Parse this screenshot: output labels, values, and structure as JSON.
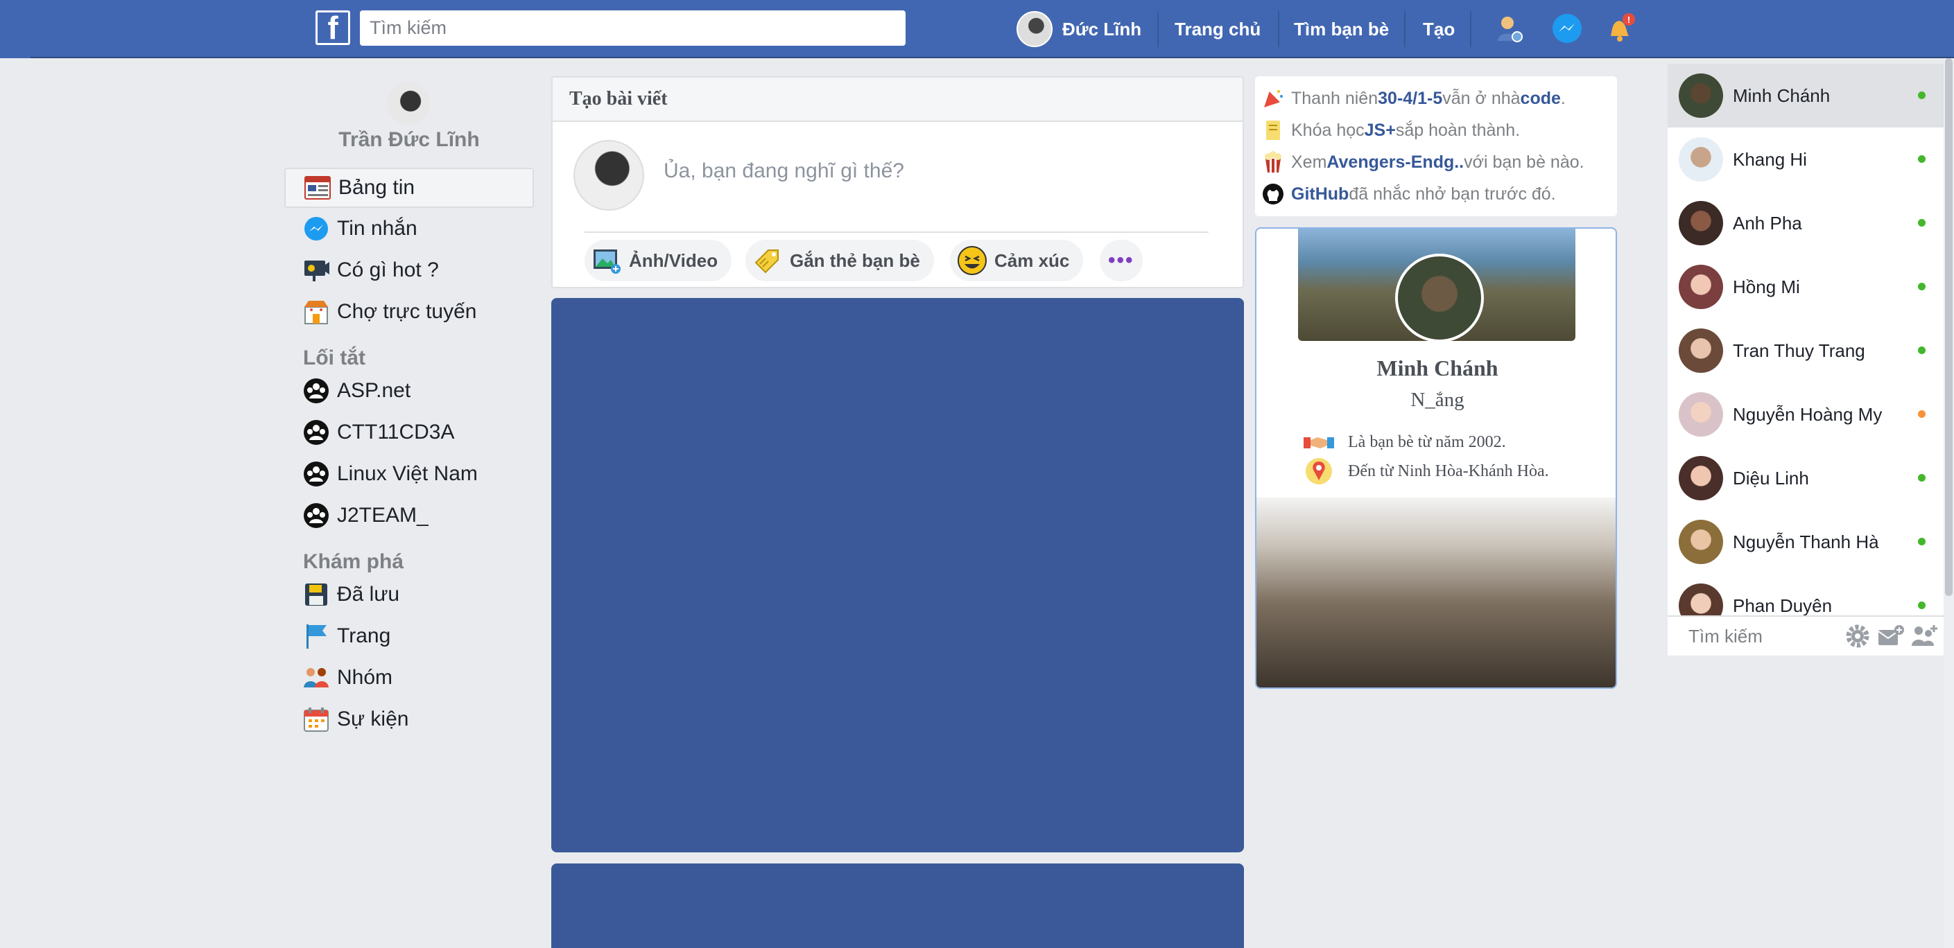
{
  "topbar": {
    "logo_letter": "f",
    "search_placeholder": "Tìm kiếm",
    "user_name": "Đức Lĩnh",
    "nav": [
      "Trang chủ",
      "Tìm bạn bè",
      "Tạo"
    ],
    "notification_badge": "!",
    "colors": {
      "bar": "#4267b2",
      "text": "#ffffff"
    }
  },
  "left_sidebar": {
    "profile_name": "Trần Đức Lĩnh",
    "main_menu": [
      {
        "label": "Bảng tin",
        "icon": "news-feed-icon",
        "active": true
      },
      {
        "label": "Tin nhắn",
        "icon": "messenger-icon"
      },
      {
        "label": "Có gì hot ?",
        "icon": "hot-video-icon"
      },
      {
        "label": "Chợ trực tuyến",
        "icon": "marketplace-icon"
      }
    ],
    "shortcuts_title": "Lối tắt",
    "shortcuts": [
      {
        "label": "ASP.net",
        "icon": "group-icon"
      },
      {
        "label": "CTT11CD3A",
        "icon": "group-icon"
      },
      {
        "label": "Linux Việt Nam",
        "icon": "group-icon"
      },
      {
        "label": "J2TEAM_",
        "icon": "group-icon"
      }
    ],
    "explore_title": "Khám phá",
    "explore": [
      {
        "label": "Đã lưu",
        "icon": "save-icon"
      },
      {
        "label": "Trang",
        "icon": "flag-icon"
      },
      {
        "label": "Nhóm",
        "icon": "people-icon"
      },
      {
        "label": "Sự kiện",
        "icon": "calendar-icon"
      }
    ]
  },
  "composer": {
    "title": "Tạo bài viết",
    "placeholder": "Ủa, bạn đang nghĩ gì thế?",
    "actions": [
      {
        "label": "Ảnh/Video",
        "icon": "photo-video-icon"
      },
      {
        "label": "Gắn thẻ bạn bè",
        "icon": "tag-friends-icon"
      },
      {
        "label": "Cảm xúc",
        "icon": "feeling-icon"
      }
    ],
    "more_label": "•••"
  },
  "notices": [
    {
      "prefix": "Thanh niên ",
      "bold": "30-4/1-5",
      "mid": " vẫn ở nhà ",
      "bold2": "code",
      "suffix": ".",
      "icon": "confetti-icon"
    },
    {
      "prefix": "Khóa học ",
      "bold": "JS+",
      "mid": " sắp hoàn thành.",
      "bold2": "",
      "suffix": "",
      "icon": "course-icon"
    },
    {
      "prefix": "Xem ",
      "bold": "Avengers-Endg..",
      "mid": " với bạn bè nào.",
      "bold2": "",
      "suffix": "",
      "icon": "popcorn-icon"
    },
    {
      "prefix": "",
      "bold": "GitHub",
      "mid": " đã nhắc nhở bạn trước đó.",
      "bold2": "",
      "suffix": "",
      "icon": "github-icon"
    }
  ],
  "friend_card": {
    "name": "Minh Chánh",
    "nickname": "N_ắng",
    "friends_since": "Là bạn bè từ năm 2002.",
    "from": "Đến từ Ninh Hòa-Khánh Hòa."
  },
  "chat": {
    "contacts": [
      {
        "name": "Minh Chánh",
        "status": "online",
        "active": true
      },
      {
        "name": "Khang Hi",
        "status": "online"
      },
      {
        "name": "Anh Pha",
        "status": "online"
      },
      {
        "name": "Hồng Mi",
        "status": "online"
      },
      {
        "name": "Tran Thuy Trang",
        "status": "online"
      },
      {
        "name": "Nguyễn Hoàng My",
        "status": "idle"
      },
      {
        "name": "Diệu Linh",
        "status": "online"
      },
      {
        "name": "Nguyễn Thanh Hà",
        "status": "online"
      },
      {
        "name": "Phan Duyên",
        "status": "online"
      }
    ],
    "search_placeholder": "Tìm kiếm",
    "status_colors": {
      "online": "#42b72a",
      "idle": "#f7923b"
    }
  }
}
